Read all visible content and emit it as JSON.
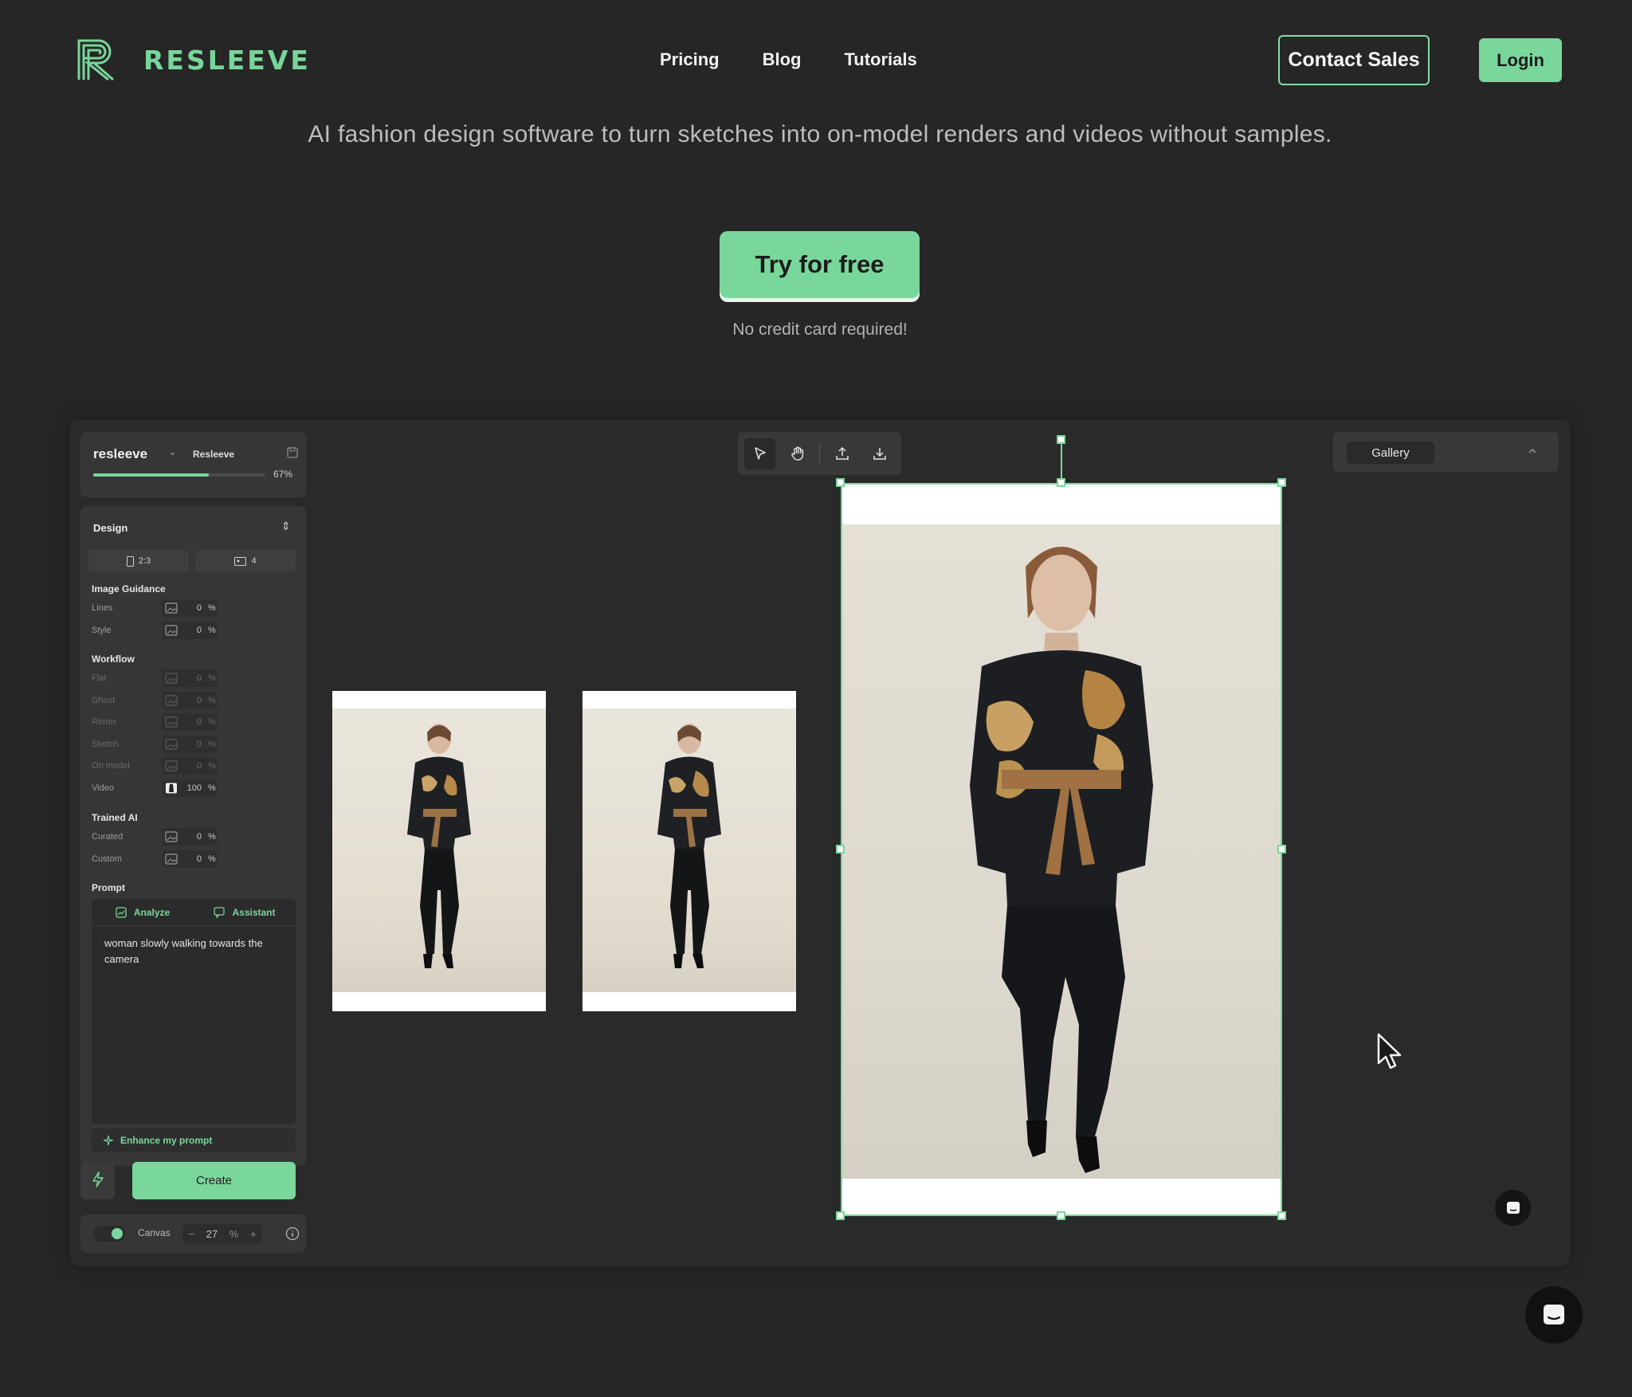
{
  "brand": {
    "name": "RESLEEVE",
    "accent": "#79d79c"
  },
  "nav": {
    "links": [
      "Pricing",
      "Blog",
      "Tutorials"
    ],
    "contact_label": "Contact Sales",
    "login_label": "Login"
  },
  "hero": {
    "tagline": "AI fashion design software to turn sketches into on-model renders and videos without samples.",
    "cta_label": "Try for free",
    "cta_note": "No credit card required!"
  },
  "app": {
    "project": {
      "name": "resleeve",
      "team": "Resleeve",
      "progress_text": "67%",
      "progress": 0.67
    },
    "design": {
      "title": "Design",
      "aspect": "2:3",
      "count": "4",
      "sections": {
        "image_guidance": "Image Guidance",
        "workflow": "Workflow",
        "trained_ai": "Trained AI",
        "prompt": "Prompt"
      },
      "image_guidance_rows": [
        {
          "label": "Lines",
          "value": "0",
          "unit": "%"
        },
        {
          "label": "Style",
          "value": "0",
          "unit": "%"
        }
      ],
      "workflow_rows": [
        {
          "label": "Flat",
          "value": "0",
          "unit": "%"
        },
        {
          "label": "Ghost",
          "value": "0",
          "unit": "%"
        },
        {
          "label": "Remix",
          "value": "0",
          "unit": "%"
        },
        {
          "label": "Sketch",
          "value": "0",
          "unit": "%"
        },
        {
          "label": "On model",
          "value": "0",
          "unit": "%"
        },
        {
          "label": "Video",
          "value": "100",
          "unit": "%"
        }
      ],
      "trained_rows": [
        {
          "label": "Curated",
          "value": "0",
          "unit": "%"
        },
        {
          "label": "Custom",
          "value": "0",
          "unit": "%"
        }
      ],
      "prompt_tabs": [
        "Analyze",
        "Assistant"
      ],
      "prompt_text": "woman slowly walking towards the camera",
      "enhance_label": "Enhance my prompt",
      "create_label": "Create"
    },
    "canvas": {
      "label": "Canvas",
      "zoom": "27",
      "unit": "%"
    },
    "gallery": {
      "tab_label": "Gallery"
    },
    "icons": [
      "select-arrow-icon",
      "hand-icon",
      "upload-icon",
      "download-icon",
      "chevron-up-icon",
      "chat-icon"
    ]
  }
}
